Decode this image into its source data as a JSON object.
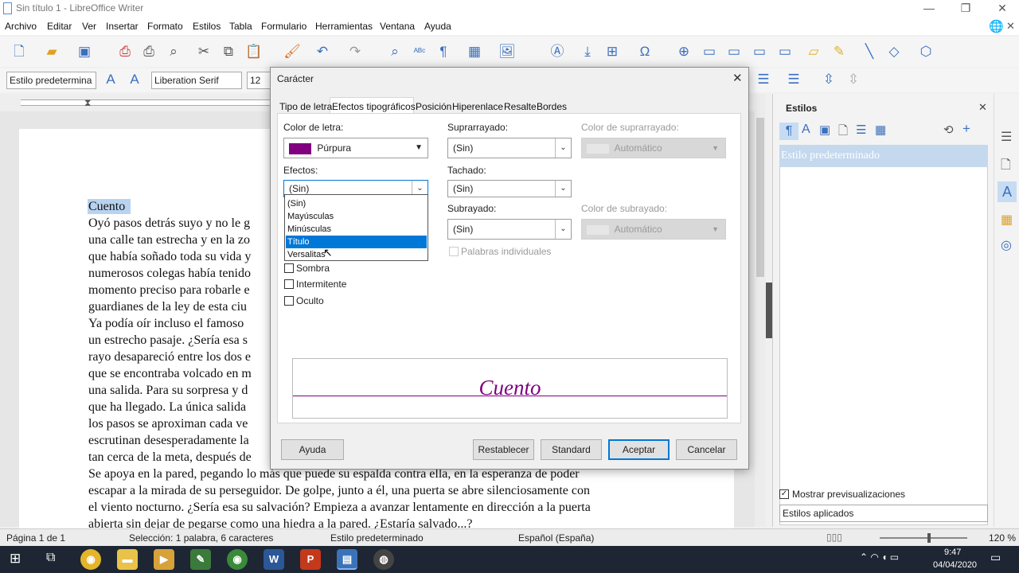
{
  "window": {
    "title": "Sin título 1 - LibreOffice Writer"
  },
  "menu": [
    "Archivo",
    "Editar",
    "Ver",
    "Insertar",
    "Formato",
    "Estilos",
    "Tabla",
    "Formulario",
    "Herramientas",
    "Ventana",
    "Ayuda"
  ],
  "toolbar2": {
    "paragraph_style": "Estilo predetermina",
    "font_name": "Liberation Serif",
    "font_size": "12"
  },
  "document": {
    "lines": [
      "Cuento",
      "Oyó pasos detrás suyo y no le g",
      "una calle tan estrecha y en la zo",
      "que había soñado toda su vida y",
      "numerosos colegas había tenido",
      "momento preciso para robarle e",
      "guardianes de la ley de esta ciu",
      "Ya podía oír incluso el famoso",
      "un estrecho pasaje. ¿Sería esa s",
      "rayo desapareció entre los dos e",
      "que se encontraba volcado en m",
      "una salida. Para su sorpresa y d",
      "que ha llegado. La única salida",
      "los pasos se aproximan cada ve",
      "escrutinan desesperadamente la",
      "tan cerca de la meta, después de",
      "Se apoya en la pared, pegando lo más que puede su espalda contra ella, en la esperanza de poder",
      "escapar a la mirada de su perseguidor. De golpe, junto a él, una puerta se abre silenciosamente con",
      "el viento nocturno. ¿Sería esa su salvación? Empieza a avanzar lentamente en dirección a la puerta",
      "abierta sin dejar de pegarse como una hiedra a la pared. ¿Estaría salvado...?"
    ]
  },
  "sidebar": {
    "title": "Estilos",
    "selected_style": "Estilo predeterminado",
    "show_previews_label": "Mostrar previsualizaciones",
    "filter_value": "Estilos aplicados"
  },
  "statusbar": {
    "page": "Página 1 de 1",
    "selection": "Selección: 1 palabra, 6 caracteres",
    "style": "Estilo predeterminado",
    "language": "Español (España)",
    "zoom": "120 %"
  },
  "taskbar": {
    "time": "9:47",
    "date": "04/04/2020"
  },
  "dialog": {
    "title": "Carácter",
    "tabs": [
      "Tipo de letra",
      "Efectos tipográficos",
      "Posición",
      "Hiperenlace",
      "Resalte",
      "Bordes"
    ],
    "active_tab": "Efectos tipográficos",
    "font_color_label": "Color de letra:",
    "font_color_value": "Púrpura",
    "font_color_hex": "#800080",
    "effects_label": "Efectos:",
    "effects_value": "(Sin)",
    "effects_options": [
      "(Sin)",
      "Mayúsculas",
      "Minúsculas",
      "Título",
      "Versalitas"
    ],
    "effects_highlighted": "Título",
    "checkboxes": [
      "Sombra",
      "Intermitente",
      "Oculto"
    ],
    "overline_label": "Suprarrayado:",
    "overline_value": "(Sin)",
    "overline_color_label": "Color de suprarrayado:",
    "overline_color_value": "Automático",
    "strike_label": "Tachado:",
    "strike_value": "(Sin)",
    "underline_label": "Subrayado:",
    "underline_value": "(Sin)",
    "underline_color_label": "Color de subrayado:",
    "underline_color_value": "Automático",
    "individual_words_label": "Palabras individuales",
    "preview_text": "Cuento",
    "buttons": {
      "help": "Ayuda",
      "reset": "Restablecer",
      "standard": "Standard",
      "ok": "Aceptar",
      "cancel": "Cancelar"
    }
  }
}
